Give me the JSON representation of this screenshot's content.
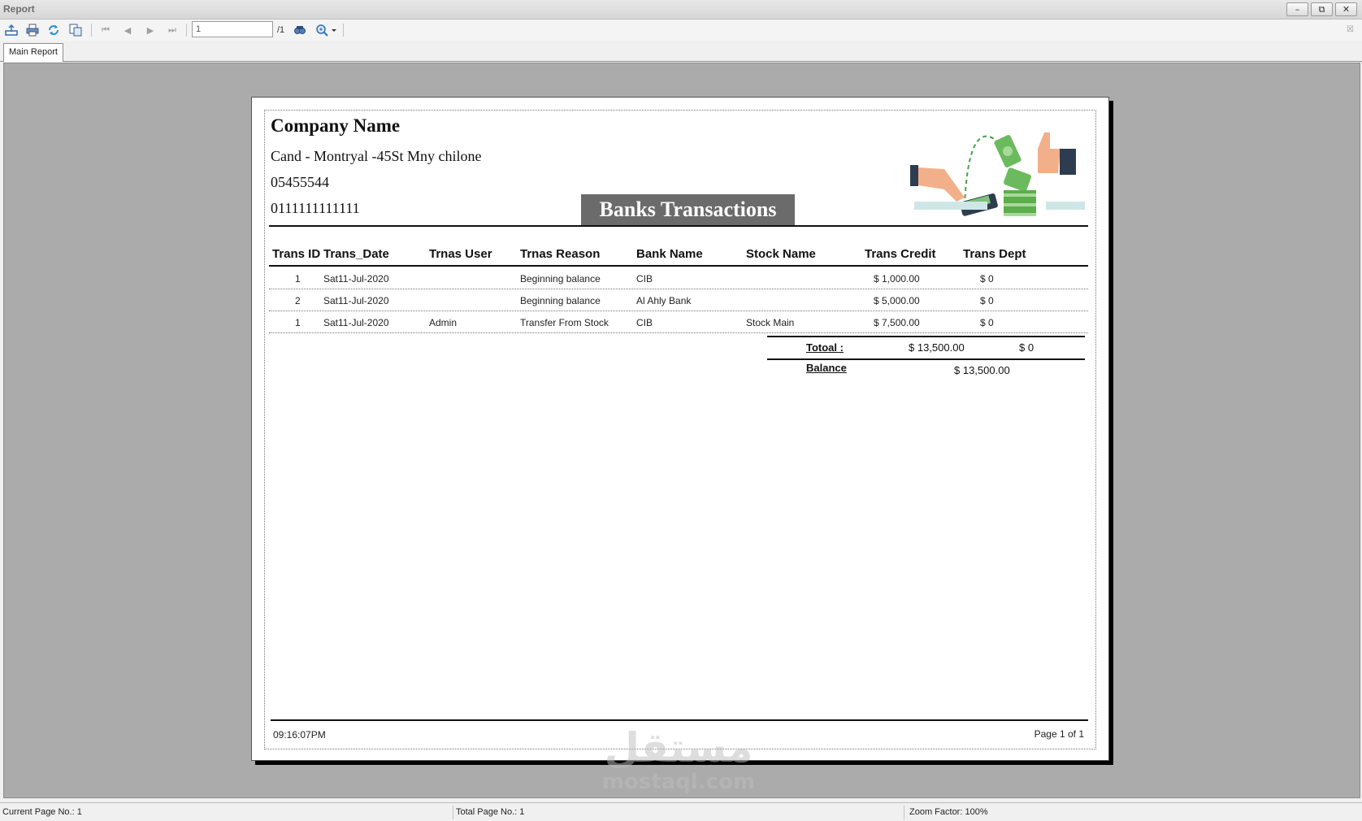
{
  "window": {
    "title": "Report",
    "controls": {
      "minimize": "–",
      "restore": "⧉",
      "close": "✕"
    }
  },
  "toolbar": {
    "icons": [
      "export-icon",
      "print-icon",
      "refresh-icon",
      "copy-icon",
      "first-page-icon",
      "previous-page-icon",
      "next-page-icon",
      "last-page-icon",
      "find-icon",
      "zoom-icon"
    ],
    "page_input_value": "1",
    "page_total": "/1",
    "close_glyph": "☒"
  },
  "tabs": [
    {
      "label": "Main Report",
      "active": true
    }
  ],
  "report": {
    "company_name": "Company Name",
    "address": "Cand - Montryal -45St Mny chilone",
    "phone1": "05455544",
    "phone2": "0111111111111",
    "banner_title": "Banks Transactions",
    "columns": [
      "Trans ID",
      "Trans_Date",
      "Trnas User",
      "Trnas Reason",
      "Bank Name",
      "Stock Name",
      "Trans Credit",
      "Trans Dept"
    ],
    "rows": [
      {
        "id": "1",
        "date": "Sat11-Jul-2020",
        "user": "",
        "reason": "Beginning balance",
        "bank": "CIB",
        "stock": "",
        "credit": "$  1,000.00",
        "dept": "$  0"
      },
      {
        "id": "2",
        "date": "Sat11-Jul-2020",
        "user": "",
        "reason": "Beginning balance",
        "bank": "Al Ahly Bank",
        "stock": "",
        "credit": "$  5,000.00",
        "dept": "$  0"
      },
      {
        "id": "1",
        "date": "Sat11-Jul-2020",
        "user": "Admin",
        "reason": "Transfer From Stock",
        "bank": "CIB",
        "stock": "Stock Main",
        "credit": "$  7,500.00",
        "dept": "$  0"
      }
    ],
    "total_label": "Totoal  :",
    "total_credit": "$  13,500.00",
    "total_dept": "$  0",
    "balance_label": "Balance",
    "balance_value": "$  13,500.00",
    "footer_time": "09:16:07PM",
    "footer_page": "Page 1 of 1"
  },
  "watermark": {
    "arabic": "مستقل",
    "latin": "mostaql.com"
  },
  "statusbar": {
    "current_page": "Current Page No.: 1",
    "total_page": "Total Page No.: 1",
    "zoom": "Zoom Factor: 100%"
  },
  "colors": {
    "viewport_bg": "#ababab",
    "banner_bg": "#6b6b6b",
    "toolbar_icon": "#2f6fb5",
    "money_green": "#5cae4a"
  }
}
